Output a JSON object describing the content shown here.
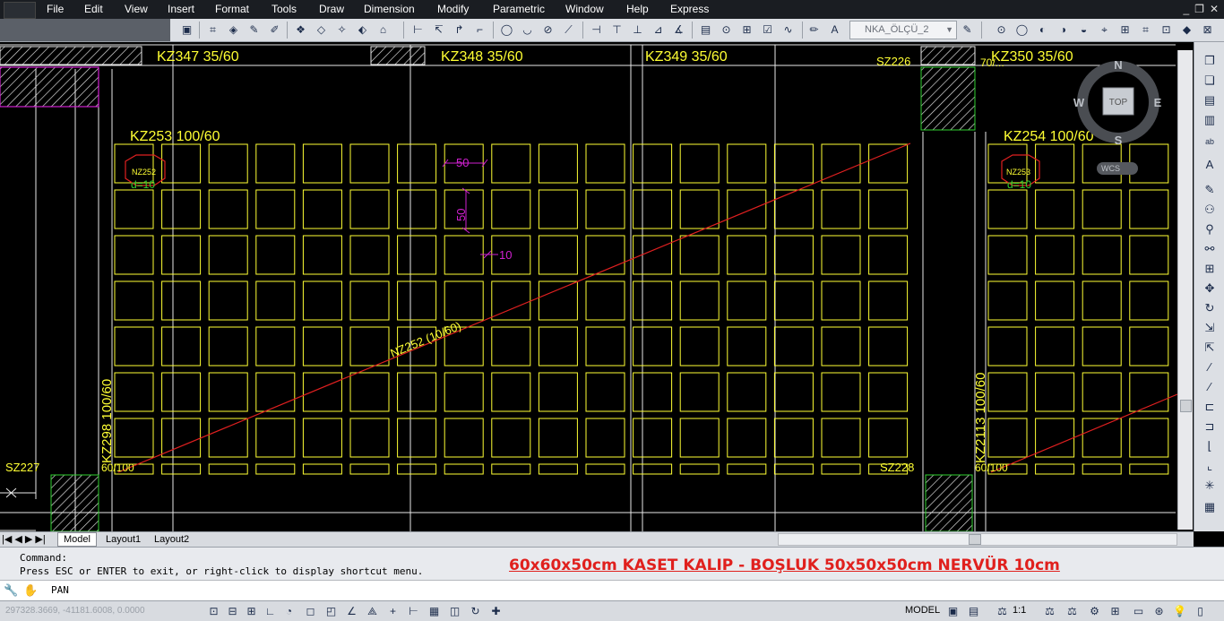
{
  "menu": {
    "items": [
      "File",
      "Edit",
      "View",
      "Insert",
      "Format",
      "Tools",
      "Draw",
      "Dimension",
      "Modify",
      "Parametric",
      "Window",
      "Help",
      "Express"
    ]
  },
  "toolbar": {
    "layer_combo": "NKA_ÖLÇÜ_2"
  },
  "drawing": {
    "beam_labels": {
      "kz347": "KZ347 35/60",
      "kz348": "KZ348 35/60",
      "kz349": "KZ349 35/60",
      "kz350": "KZ350 35/60",
      "kz253": "KZ253 100/60",
      "kz254": "KZ254 100/60",
      "kz298": "KZ298 100/60",
      "kz2113": "KZ2113 100/60"
    },
    "column_labels": {
      "sz226": "SZ226",
      "sz227": "SZ227",
      "sz228": "SZ228",
      "partial_70": "70/..."
    },
    "slab_tags": {
      "left_slab": "NZ252",
      "left_thk": "d=10",
      "right_slab": "NZ253",
      "right_thk": "d=10"
    },
    "dims": {
      "w": "50",
      "h": "50",
      "rib": "10"
    },
    "rib_beam": "NZ252 (10/60)",
    "left_size": "60/100",
    "right_size": "60/100"
  },
  "viewcube": {
    "north": "N",
    "south": "S",
    "east": "E",
    "west": "W",
    "face": "TOP",
    "ucs": "WCS"
  },
  "layout_tabs": [
    "Model",
    "Layout1",
    "Layout2"
  ],
  "command": {
    "line1": "Command:",
    "line2": "Press ESC or ENTER to exit, or right-click to display shortcut menu.",
    "current": "PAN",
    "annotation": "60x60x50cm KASET KALIP - BOŞLUK 50x50x50cm NERVÜR 10cm"
  },
  "status": {
    "coords": "297328.3669, -41181.6008, 0.0000",
    "model": "MODEL",
    "scale": "1:1"
  },
  "colors": {
    "yellow": "#ffff33",
    "magenta": "#d020d0",
    "red": "#e02020",
    "green": "#30d030",
    "annotation": "#e0201d"
  }
}
